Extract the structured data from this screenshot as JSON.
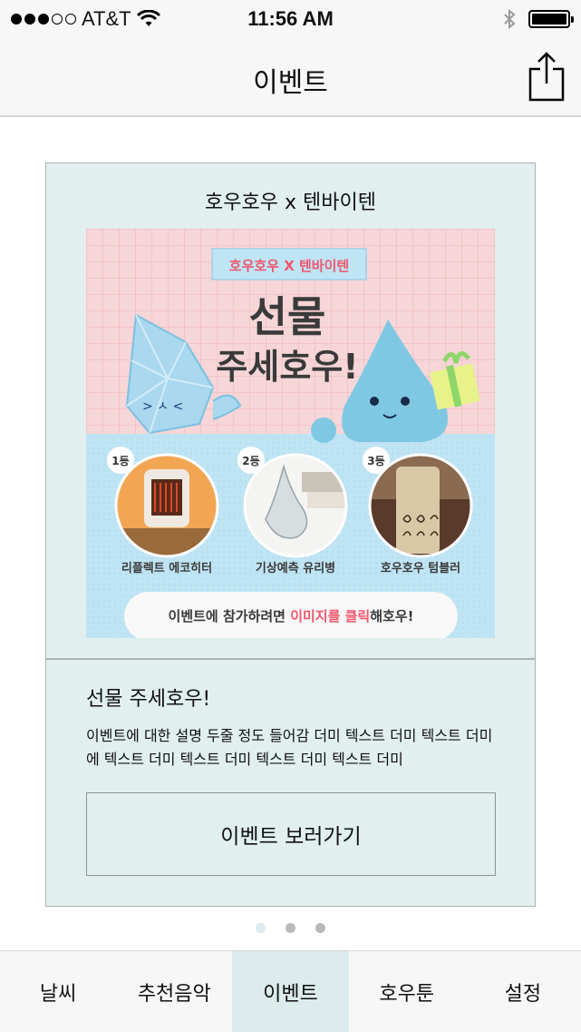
{
  "status_bar": {
    "carrier": "AT&T",
    "time": "11:56 AM"
  },
  "nav": {
    "title": "이벤트"
  },
  "card": {
    "title": "호우호우 x 텐바이텐",
    "banner": {
      "tag": "호우호우 X 텐바이텐",
      "headline_1": "선물",
      "headline_2": "주세호우!",
      "prizes": [
        {
          "rank": "1등",
          "name": "리플렉트 에코히터"
        },
        {
          "rank": "2등",
          "name": "기상예측 유리병"
        },
        {
          "rank": "3등",
          "name": "호우호우 텀블러"
        }
      ],
      "footer_prefix": "이벤트에 참가하려면 ",
      "footer_highlight": "이미지를 클릭",
      "footer_suffix": "해호우!"
    },
    "subtitle": "선물 주세호우!",
    "description": "이벤트에 대한 설명 두줄 정도 들어감 더미 텍스트 더미 텍스트 더미에 텍스트 더미 텍스트 더미 텍스트 더미 텍스트 더미",
    "cta_label": "이벤트 보러가기"
  },
  "pager": {
    "count": 3,
    "active_index": 0
  },
  "tabs": [
    {
      "label": "날씨"
    },
    {
      "label": "추천음악"
    },
    {
      "label": "이벤트",
      "active": true
    },
    {
      "label": "호우툰"
    },
    {
      "label": "설정"
    }
  ],
  "colors": {
    "card_bg": "#e1efee",
    "active_tab": "#dcebeb",
    "highlight": "#f0566c",
    "banner_pink": "#f6d6d8",
    "banner_blue": "#bfe4f4"
  }
}
